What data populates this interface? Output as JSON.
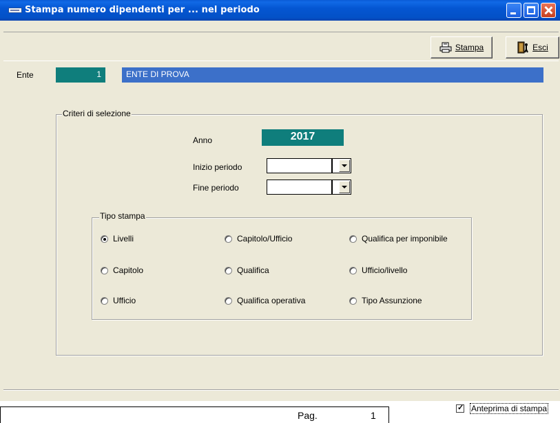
{
  "window": {
    "title": "Stampa numero dipendenti per ...  nel periodo"
  },
  "toolbar": {
    "stampa_label": "Stampa",
    "esci_label": "Esci"
  },
  "ente": {
    "label": "Ente",
    "code": "1",
    "name": "ENTE DI PROVA"
  },
  "criteri": {
    "legend": "Criteri di selezione",
    "anno_label": "Anno",
    "anno_value": "2017",
    "inizio_label": "Inizio periodo",
    "inizio_value": "",
    "fine_label": "Fine periodo",
    "fine_value": ""
  },
  "tipo_stampa": {
    "legend": "Tipo stampa",
    "options": [
      {
        "label": "Livelli",
        "selected": true
      },
      {
        "label": "Capitolo/Ufficio",
        "selected": false
      },
      {
        "label": "Qualifica per imponibile",
        "selected": false
      },
      {
        "label": "Capitolo",
        "selected": false
      },
      {
        "label": "Qualifica",
        "selected": false
      },
      {
        "label": "Ufficio/livello",
        "selected": false
      },
      {
        "label": "Ufficio",
        "selected": false
      },
      {
        "label": "Qualifica operativa",
        "selected": false
      },
      {
        "label": "Tipo Assunzione",
        "selected": false
      }
    ]
  },
  "anteprima": {
    "label": "Anteprima di stampa",
    "checked": true
  },
  "pagebar": {
    "label": "Pag.",
    "number": "1"
  },
  "colors": {
    "teal": "#0f7e7c",
    "blue_field": "#3c70c9",
    "titlebar": "#0351c7",
    "face": "#ece9d8"
  }
}
